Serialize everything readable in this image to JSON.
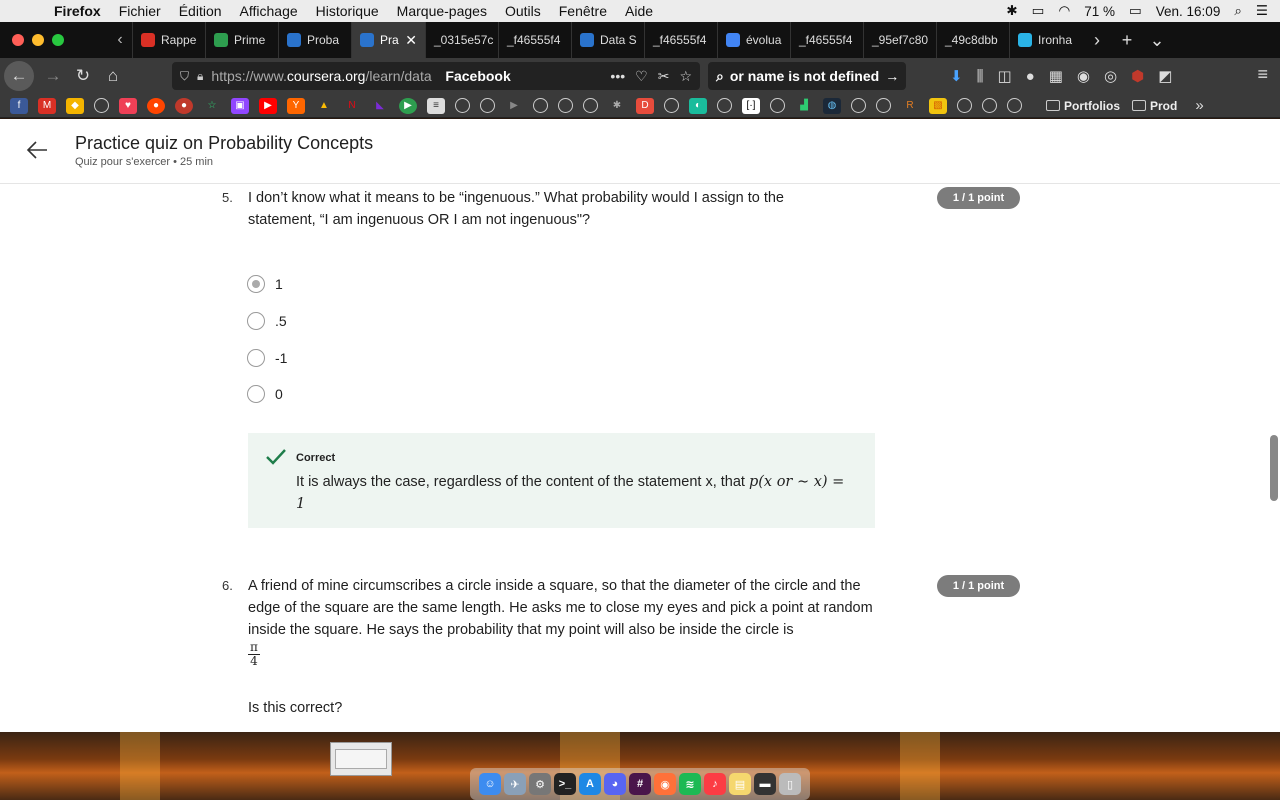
{
  "menubar": {
    "app": "Firefox",
    "items": [
      "Fichier",
      "Édition",
      "Affichage",
      "Historique",
      "Marque-pages",
      "Outils",
      "Fenêtre",
      "Aide"
    ],
    "battery": "71 %",
    "clock": "Ven. 16:09"
  },
  "tabs": [
    {
      "label": "Rappe",
      "icon": "gmail-icon",
      "color": "#d93025"
    },
    {
      "label": "Prime",
      "icon": "play-icon",
      "color": "#2e9e4f"
    },
    {
      "label": "Proba",
      "icon": "coursera-icon",
      "color": "#2a73cc"
    },
    {
      "label": "Pra",
      "icon": "coursera-icon",
      "color": "#2a73cc",
      "active": true
    },
    {
      "label": "_0315e57c",
      "icon": "",
      "color": ""
    },
    {
      "label": "_f46555f4",
      "icon": "",
      "color": ""
    },
    {
      "label": "Data S",
      "icon": "coursera-icon",
      "color": "#2a73cc"
    },
    {
      "label": "_f46555f4",
      "icon": "",
      "color": ""
    },
    {
      "label": "évolua",
      "icon": "google-icon",
      "color": "#4285f4"
    },
    {
      "label": "_f46555f4",
      "icon": "",
      "color": ""
    },
    {
      "label": "_95ef7c80",
      "icon": "",
      "color": ""
    },
    {
      "label": "_49c8dbb",
      "icon": "",
      "color": ""
    },
    {
      "label": "Ironha",
      "icon": "ironhack-icon",
      "color": "#2ab3e6"
    }
  ],
  "navbar": {
    "url_prefix": "https://www.",
    "url_domain": "coursera.org",
    "url_path": "/learn/data",
    "site_label": "Facebook",
    "search_text": "or name is not defined"
  },
  "bookmarks": {
    "folders": [
      "Portfolios",
      "Prod"
    ]
  },
  "page": {
    "title": "Practice quiz on Probability Concepts",
    "subtitle": "Quiz pour s'exercer • 25  min",
    "q5": {
      "number": "5.",
      "text": "I don’t know what it means to be “ingenuous.” What probability would I assign to the statement, “I am ingenuous OR I am not ingenuous\"?",
      "points": "1 / 1 point",
      "options": [
        "1",
        ".5",
        "-1",
        "0"
      ],
      "selected_index": 0,
      "feedback_title": "Correct",
      "feedback_text": "It is always the case, regardless of the content of the statement x, that ",
      "feedback_math": "p(x or ∼ x) = 1"
    },
    "q6": {
      "number": "6.",
      "text": "A friend of mine circumscribes a circle inside a square, so that the diameter of the circle and the edge of the square are the same length. He asks me to close my eyes and pick a point at random inside the square. He says the probability that my point will also be inside the circle is",
      "frac_num": "π",
      "frac_den": "4",
      "question": "Is this correct?",
      "points": "1 / 1 point"
    }
  }
}
